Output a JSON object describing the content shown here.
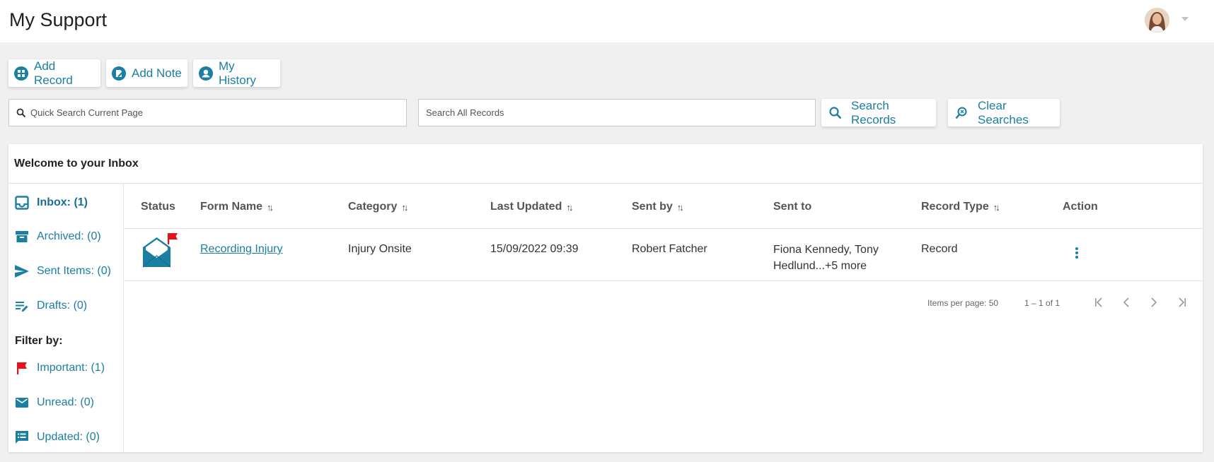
{
  "app": {
    "title": "My Support"
  },
  "toolbar": {
    "add_record": "Add Record",
    "add_note": "Add Note",
    "my_history": "My History"
  },
  "search": {
    "quick_placeholder": "Quick Search Current Page",
    "all_placeholder": "Search All Records",
    "search_records": "Search Records",
    "clear_searches": "Clear Searches"
  },
  "inbox": {
    "title": "Welcome to your Inbox",
    "folders": [
      {
        "label": "Inbox: (1)",
        "icon": "inbox-icon"
      },
      {
        "label": "Archived: (0)",
        "icon": "archive-icon"
      },
      {
        "label": "Sent Items: (0)",
        "icon": "send-icon"
      },
      {
        "label": "Drafts: (0)",
        "icon": "drafts-icon"
      }
    ],
    "filter_label": "Filter by:",
    "filters": [
      {
        "label": "Important: (1)",
        "icon": "flag-icon"
      },
      {
        "label": "Unread: (0)",
        "icon": "mail-icon"
      },
      {
        "label": "Updated: (0)",
        "icon": "updated-icon"
      }
    ]
  },
  "table": {
    "columns": {
      "status": "Status",
      "form_name": "Form Name",
      "category": "Category",
      "last_updated": "Last Updated",
      "sent_by": "Sent by",
      "sent_to": "Sent to",
      "record_type": "Record Type",
      "action": "Action"
    },
    "sort_glyph": "↑↓",
    "rows": [
      {
        "form_name": "Recording Injury",
        "category": "Injury Onsite",
        "last_updated": "15/09/2022 09:39",
        "sent_by": "Robert Fatcher",
        "sent_to_line1": "Fiona Kennedy, Tony",
        "sent_to_line2": "Hedlund...+5 more",
        "record_type": "Record",
        "status_icon": "open-envelope-flagged-icon"
      }
    ]
  },
  "pagination": {
    "items_per_page": "Items per page: 50",
    "range": "1 – 1 of 1"
  },
  "colors": {
    "accent": "#1a7fa3",
    "flag": "#e8101a",
    "background": "#f0f0f0"
  }
}
